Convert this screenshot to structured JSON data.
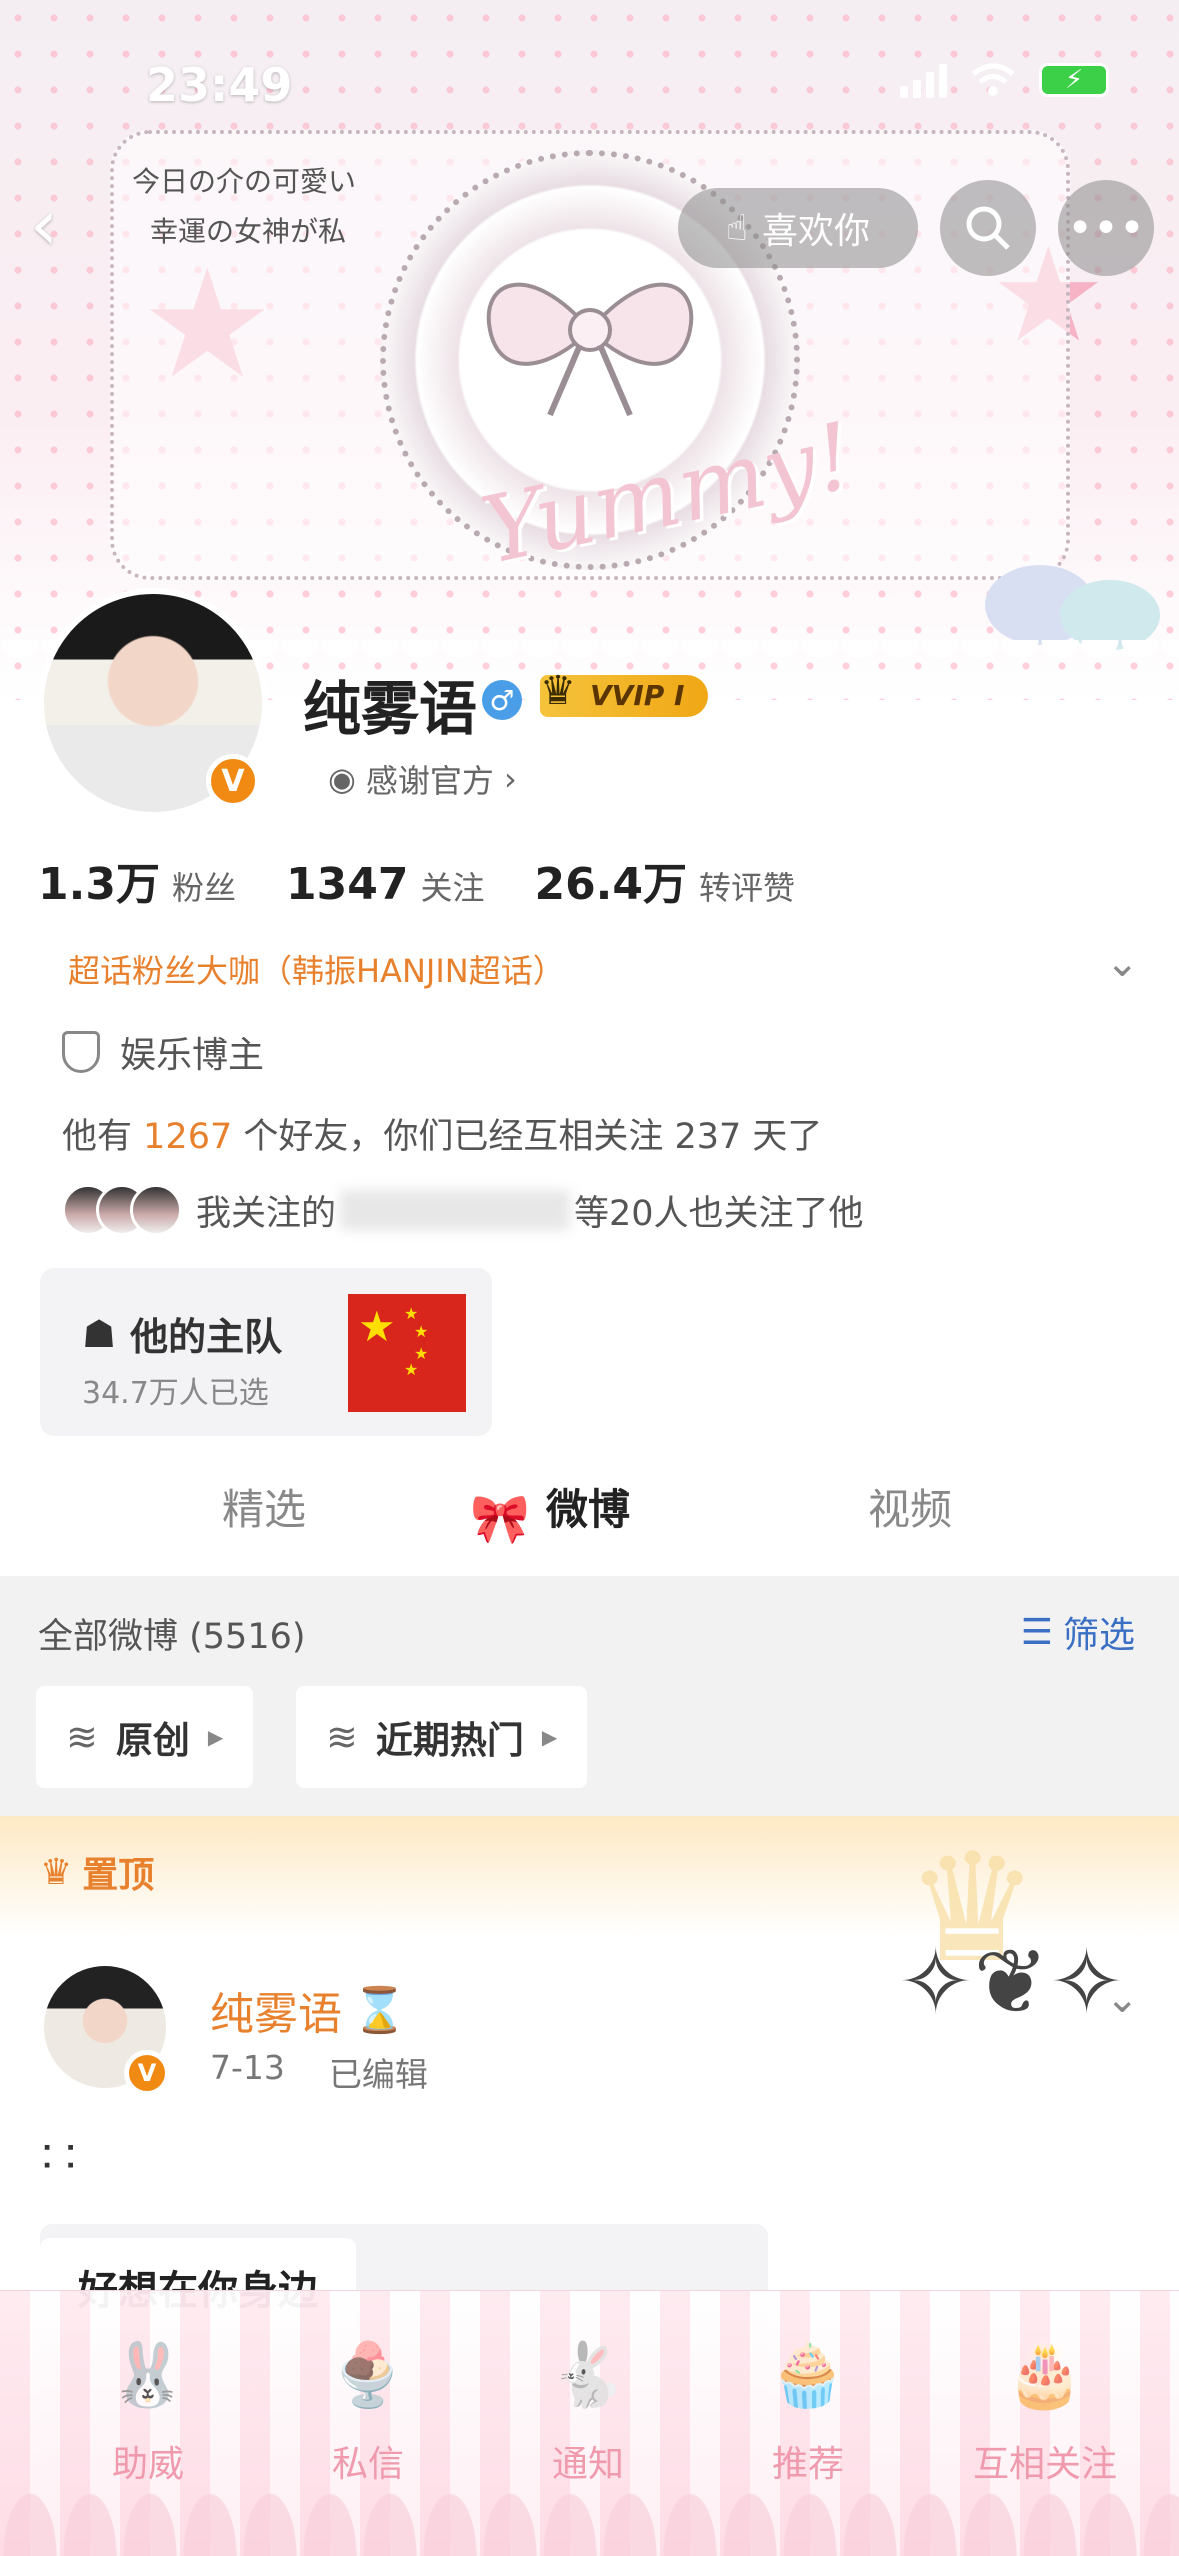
{
  "status_bar": {
    "time": "23:49"
  },
  "header": {
    "like_label": "喜欢你",
    "banner_text": [
      "今日の介の可愛い",
      "幸運の女神が私"
    ],
    "banner_word": "Yummy!"
  },
  "profile": {
    "name": "纯雾语",
    "vip_label": "VVIP I",
    "thanks_label": "感谢官方",
    "stats": [
      {
        "num": "1.3万",
        "label": "粉丝"
      },
      {
        "num": "1347",
        "label": "关注"
      },
      {
        "num": "26.4万",
        "label": "转评赞"
      }
    ],
    "super_fan": "超话粉丝大咖（韩振HANJIN超话）",
    "category": "娱乐博主",
    "friends_prefix": "他有",
    "friends_count": "1267",
    "friends_suffix": "个好友，你们已经互相关注 237 天了",
    "mutual_prefix": "我关注的",
    "mutual_suffix": "等20人也关注了他",
    "team_title": "他的主队",
    "team_sub": "34.7万人已选"
  },
  "tabs": [
    "精选",
    "微博",
    "视频"
  ],
  "feed": {
    "all_label": "全部微博 (5516)",
    "filter_label": "筛选",
    "chips": [
      "原创",
      "近期热门"
    ],
    "pinned_label": "置顶"
  },
  "post": {
    "author": "纯雾语",
    "date": "7-13",
    "edited": "已编辑",
    "text": "⠅⠅",
    "quote": "好想在你身边"
  },
  "bottom_nav": [
    "助威",
    "私信",
    "通知",
    "推荐",
    "互相关注"
  ]
}
